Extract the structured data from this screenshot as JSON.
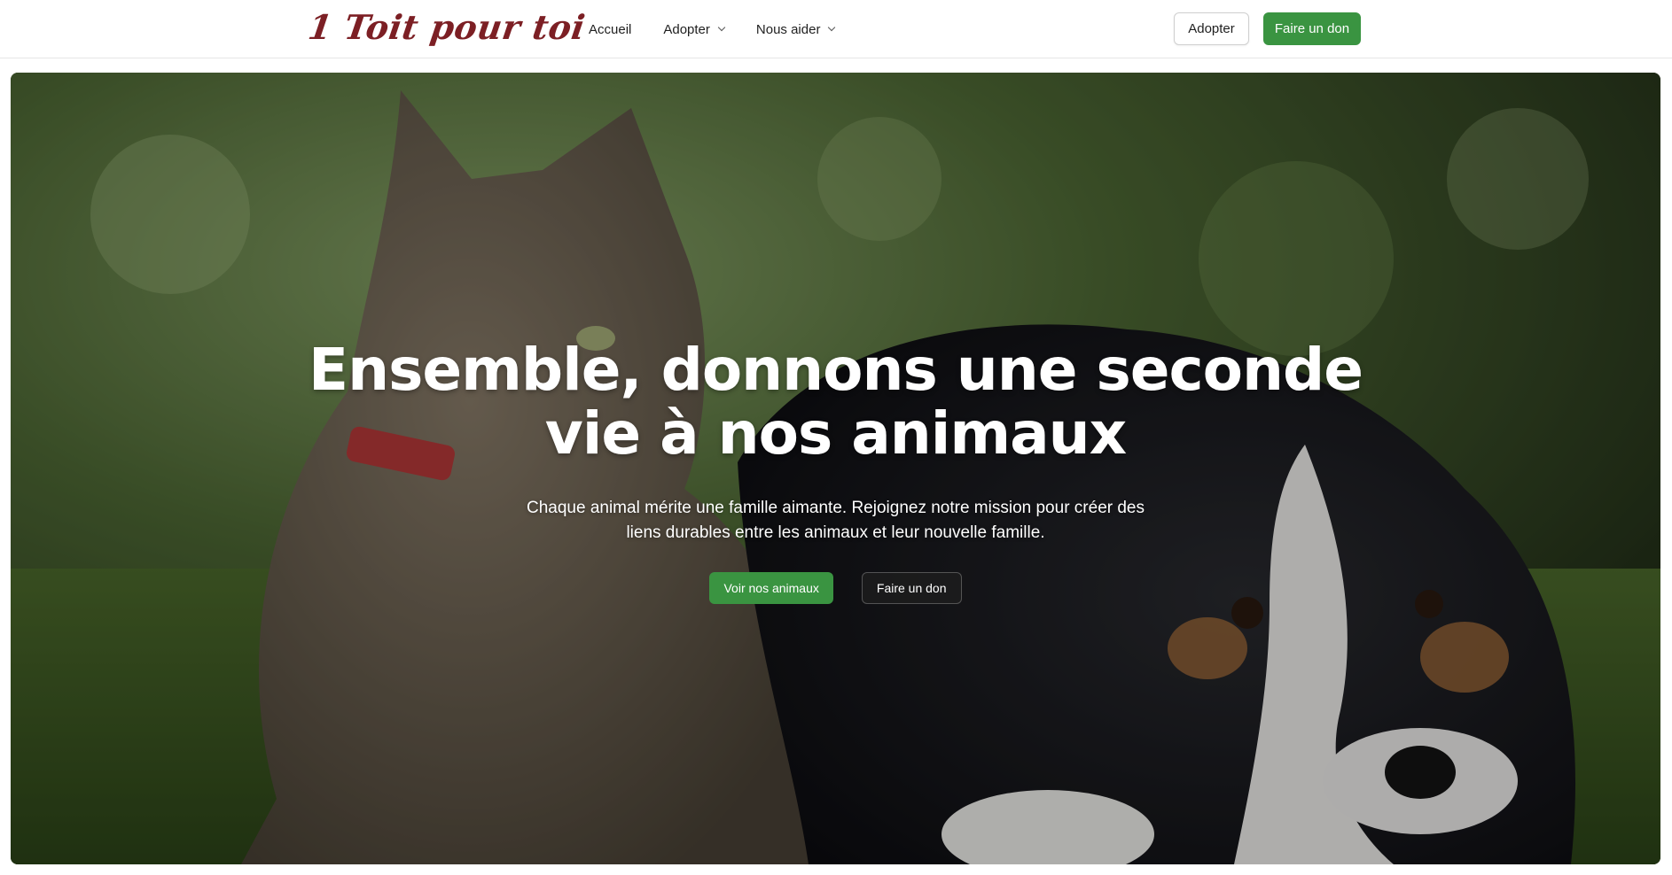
{
  "header": {
    "logo_text": "1 Toit pour toi",
    "nav": [
      {
        "label": "Accueil",
        "has_dropdown": false
      },
      {
        "label": "Adopter",
        "has_dropdown": true
      },
      {
        "label": "Nous aider",
        "has_dropdown": true
      }
    ],
    "adopt_button": "Adopter",
    "donate_button": "Faire un don"
  },
  "hero": {
    "title": "Ensemble, donnons une seconde vie à nos animaux",
    "subtitle": "Chaque animal mérite une famille aimante. Rejoignez notre mission pour créer des liens durables entre les animaux et leur nouvelle famille.",
    "primary_button": "Voir nos animaux",
    "secondary_button": "Faire un don",
    "image": "cat-and-puppy-lying-in-grass"
  },
  "colors": {
    "brand": "#7c1f24",
    "accent_green": "#3a9441"
  }
}
